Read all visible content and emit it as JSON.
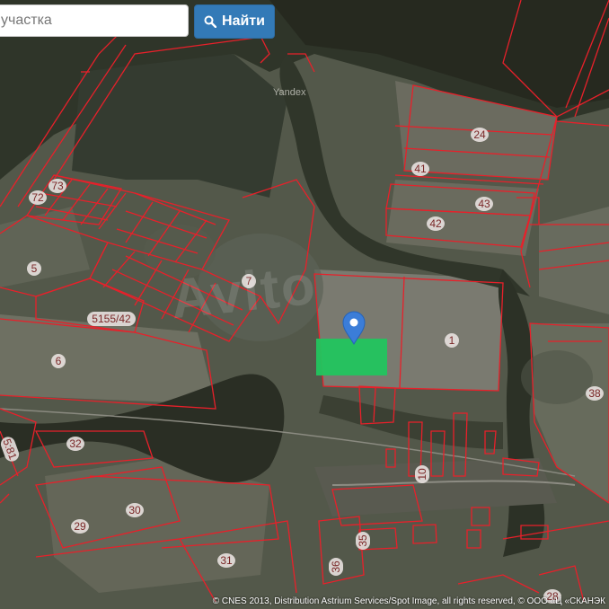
{
  "search": {
    "placeholder": "участка",
    "button_label": "Найти",
    "button_icon": "search-icon"
  },
  "map": {
    "provider_label": "Yandex",
    "watermark": "Avito",
    "attribution": "© CNES 2013, Distribution Astrium Services/Spot Image, all rights reserved, © ООО «Ц «СКАНЭК",
    "selected_marker_icon": "map-pin-icon",
    "selected_plot_color": "#22c55e",
    "boundary_color": "#e8202a",
    "parcel_labels": [
      "24",
      "41",
      "43",
      "42",
      "73",
      "72",
      "5",
      "7",
      "5155/42",
      "1",
      "6",
      "38",
      "32",
      "5:81",
      "10",
      "30",
      "29",
      "31",
      "35",
      "36",
      "28"
    ]
  }
}
